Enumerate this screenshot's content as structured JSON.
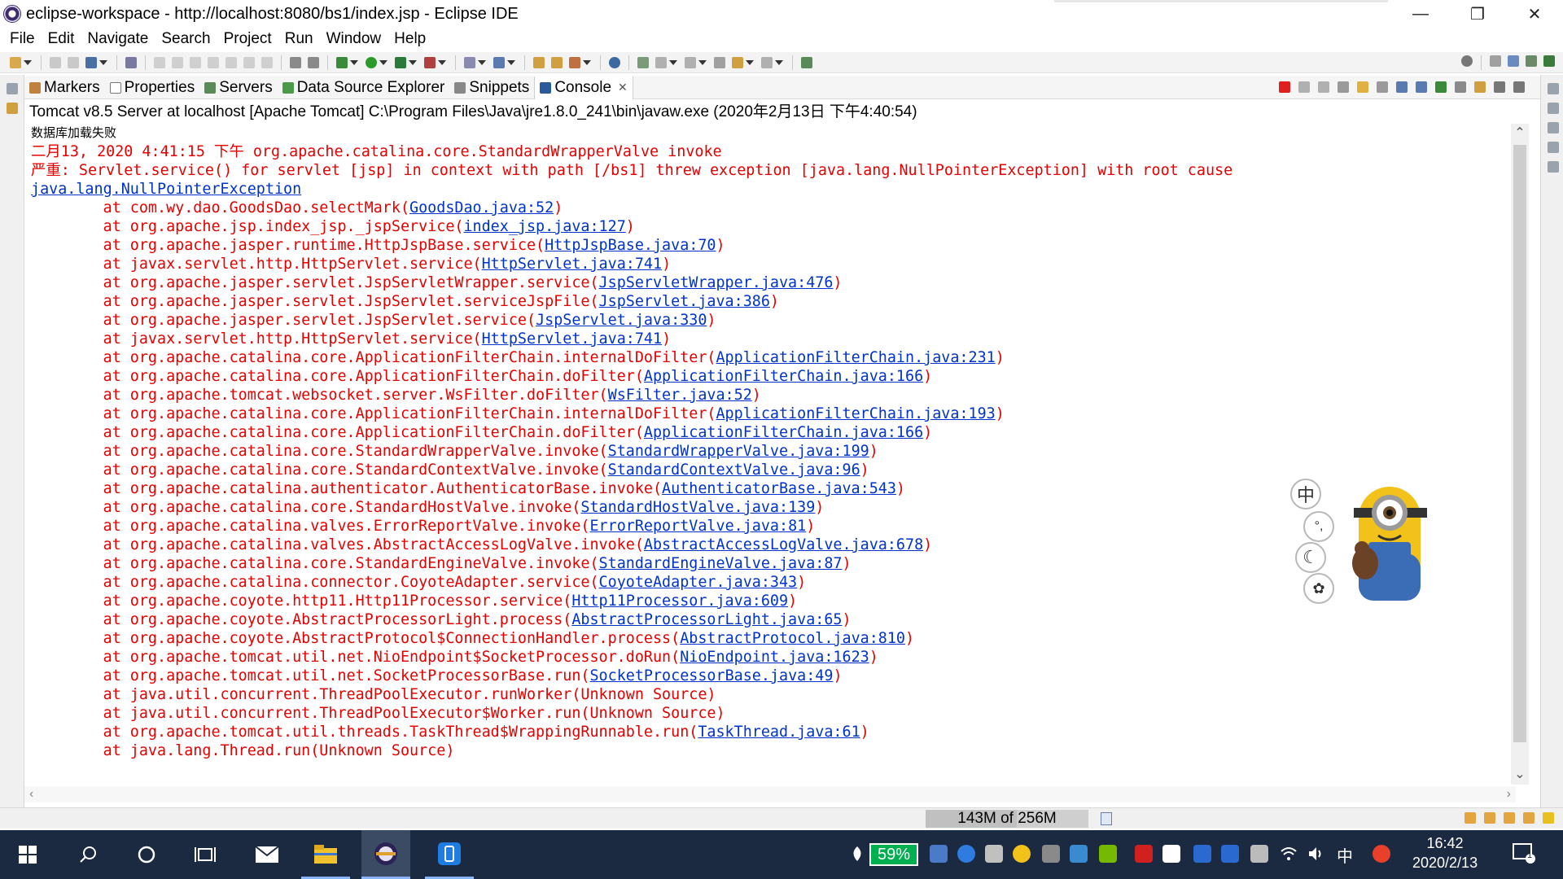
{
  "window": {
    "title": "eclipse-workspace - http://localhost:8080/bs1/index.jsp - Eclipse IDE",
    "minimize": "—",
    "restore": "❐",
    "close": "✕"
  },
  "menu": [
    "File",
    "Edit",
    "Navigate",
    "Search",
    "Project",
    "Run",
    "Window",
    "Help"
  ],
  "view_tabs": [
    {
      "label": "Markers",
      "icon": "markers-icon"
    },
    {
      "label": "Properties",
      "icon": "properties-icon"
    },
    {
      "label": "Servers",
      "icon": "servers-icon"
    },
    {
      "label": "Data Source Explorer",
      "icon": "data-source-icon"
    },
    {
      "label": "Snippets",
      "icon": "snippets-icon"
    },
    {
      "label": "Console",
      "icon": "console-icon",
      "active": true,
      "close": "✕"
    }
  ],
  "console": {
    "description": "Tomcat v8.5 Server at localhost [Apache Tomcat] C:\\Program Files\\Java\\jre1.8.0_241\\bin\\javaw.exe (2020年2月13日 下午4:40:54)",
    "lines": [
      {
        "type": "plain",
        "text": "数据库加载失败"
      },
      {
        "type": "err",
        "text": "二月13, 2020 4:41:15 下午 org.apache.catalina.core.StandardWrapperValve invoke"
      },
      {
        "type": "err",
        "text": "严重: Servlet.service() for servlet [jsp] in context with path [/bs1] threw exception [java.lang.NullPointerException] with root cause"
      },
      {
        "type": "linkline",
        "text": "java.lang.NullPointerException"
      },
      {
        "type": "err",
        "text": "\tat com.wy.dao.GoodsDao.selectMark(",
        "link": "GoodsDao.java:52",
        "tail": ")"
      },
      {
        "type": "err",
        "text": "\tat org.apache.jsp.index_jsp._jspService(",
        "link": "index_jsp.java:127",
        "tail": ")"
      },
      {
        "type": "err",
        "text": "\tat org.apache.jasper.runtime.HttpJspBase.service(",
        "link": "HttpJspBase.java:70",
        "tail": ")"
      },
      {
        "type": "err",
        "text": "\tat javax.servlet.http.HttpServlet.service(",
        "link": "HttpServlet.java:741",
        "tail": ")"
      },
      {
        "type": "err",
        "text": "\tat org.apache.jasper.servlet.JspServletWrapper.service(",
        "link": "JspServletWrapper.java:476",
        "tail": ")"
      },
      {
        "type": "err",
        "text": "\tat org.apache.jasper.servlet.JspServlet.serviceJspFile(",
        "link": "JspServlet.java:386",
        "tail": ")"
      },
      {
        "type": "err",
        "text": "\tat org.apache.jasper.servlet.JspServlet.service(",
        "link": "JspServlet.java:330",
        "tail": ")"
      },
      {
        "type": "err",
        "text": "\tat javax.servlet.http.HttpServlet.service(",
        "link": "HttpServlet.java:741",
        "tail": ")"
      },
      {
        "type": "err",
        "text": "\tat org.apache.catalina.core.ApplicationFilterChain.internalDoFilter(",
        "link": "ApplicationFilterChain.java:231",
        "tail": ")"
      },
      {
        "type": "err",
        "text": "\tat org.apache.catalina.core.ApplicationFilterChain.doFilter(",
        "link": "ApplicationFilterChain.java:166",
        "tail": ")"
      },
      {
        "type": "err",
        "text": "\tat org.apache.tomcat.websocket.server.WsFilter.doFilter(",
        "link": "WsFilter.java:52",
        "tail": ")"
      },
      {
        "type": "err",
        "text": "\tat org.apache.catalina.core.ApplicationFilterChain.internalDoFilter(",
        "link": "ApplicationFilterChain.java:193",
        "tail": ")"
      },
      {
        "type": "err",
        "text": "\tat org.apache.catalina.core.ApplicationFilterChain.doFilter(",
        "link": "ApplicationFilterChain.java:166",
        "tail": ")"
      },
      {
        "type": "err",
        "text": "\tat org.apache.catalina.core.StandardWrapperValve.invoke(",
        "link": "StandardWrapperValve.java:199",
        "tail": ")"
      },
      {
        "type": "err",
        "text": "\tat org.apache.catalina.core.StandardContextValve.invoke(",
        "link": "StandardContextValve.java:96",
        "tail": ")"
      },
      {
        "type": "err",
        "text": "\tat org.apache.catalina.authenticator.AuthenticatorBase.invoke(",
        "link": "AuthenticatorBase.java:543",
        "tail": ")"
      },
      {
        "type": "err",
        "text": "\tat org.apache.catalina.core.StandardHostValve.invoke(",
        "link": "StandardHostValve.java:139",
        "tail": ")"
      },
      {
        "type": "err",
        "text": "\tat org.apache.catalina.valves.ErrorReportValve.invoke(",
        "link": "ErrorReportValve.java:81",
        "tail": ")"
      },
      {
        "type": "err",
        "text": "\tat org.apache.catalina.valves.AbstractAccessLogValve.invoke(",
        "link": "AbstractAccessLogValve.java:678",
        "tail": ")"
      },
      {
        "type": "err",
        "text": "\tat org.apache.catalina.core.StandardEngineValve.invoke(",
        "link": "StandardEngineValve.java:87",
        "tail": ")"
      },
      {
        "type": "err",
        "text": "\tat org.apache.catalina.connector.CoyoteAdapter.service(",
        "link": "CoyoteAdapter.java:343",
        "tail": ")"
      },
      {
        "type": "err",
        "text": "\tat org.apache.coyote.http11.Http11Processor.service(",
        "link": "Http11Processor.java:609",
        "tail": ")"
      },
      {
        "type": "err",
        "text": "\tat org.apache.coyote.AbstractProcessorLight.process(",
        "link": "AbstractProcessorLight.java:65",
        "tail": ")"
      },
      {
        "type": "err",
        "text": "\tat org.apache.coyote.AbstractProtocol$ConnectionHandler.process(",
        "link": "AbstractProtocol.java:810",
        "tail": ")"
      },
      {
        "type": "err",
        "text": "\tat org.apache.tomcat.util.net.NioEndpoint$SocketProcessor.doRun(",
        "link": "NioEndpoint.java:1623",
        "tail": ")"
      },
      {
        "type": "err",
        "text": "\tat org.apache.tomcat.util.net.SocketProcessorBase.run(",
        "link": "SocketProcessorBase.java:49",
        "tail": ")"
      },
      {
        "type": "err",
        "text": "\tat java.util.concurrent.ThreadPoolExecutor.runWorker(Unknown Source)"
      },
      {
        "type": "err",
        "text": "\tat java.util.concurrent.ThreadPoolExecutor$Worker.run(Unknown Source)"
      },
      {
        "type": "err",
        "text": "\tat org.apache.tomcat.util.threads.TaskThread$WrappingRunnable.run(",
        "link": "TaskThread.java:61",
        "tail": ")"
      },
      {
        "type": "err",
        "text": "\tat java.lang.Thread.run(Unknown Source)"
      }
    ]
  },
  "status": {
    "heap": "143M of 256M",
    "heap_used_fraction": 0.56
  },
  "ime_widget": {
    "bubble_chars": [
      "中",
      "°,",
      "☾",
      "✿"
    ]
  },
  "taskbar": {
    "battery": "59%",
    "ime": "中",
    "time": "16:42",
    "date": "2020/2/13",
    "notification_count": "1"
  },
  "colors": {
    "error_text": "#e60000",
    "link_text": "#0033cc",
    "taskbar_bg": "#1b2a40",
    "battery_green": "#00b050"
  }
}
